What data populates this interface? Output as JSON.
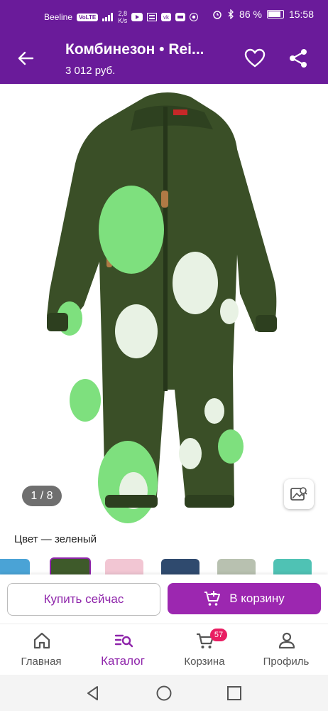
{
  "status_bar": {
    "carrier": "Beeline",
    "volte": "VoLTE",
    "speed_value": "2,8",
    "speed_unit": "K/s",
    "battery": "86 %",
    "time": "15:58"
  },
  "header": {
    "title": "Комбинезон • Rei...",
    "price": "3 012 руб."
  },
  "gallery": {
    "counter": "1 / 8"
  },
  "color": {
    "label": "Цвет — зеленый"
  },
  "actions": {
    "buy_now": "Купить сейчас",
    "add_to_cart": "В корзину"
  },
  "bottom_nav": {
    "items": [
      {
        "label": "Главная",
        "icon": "home-icon"
      },
      {
        "label": "Каталог",
        "icon": "catalog-search-icon",
        "active": true
      },
      {
        "label": "Корзина",
        "icon": "cart-icon",
        "badge": "57"
      },
      {
        "label": "Профиль",
        "icon": "profile-icon"
      }
    ]
  },
  "colors": {
    "brand": "#6a1b9a",
    "accent": "#9c27b0",
    "badge": "#e91e63"
  }
}
